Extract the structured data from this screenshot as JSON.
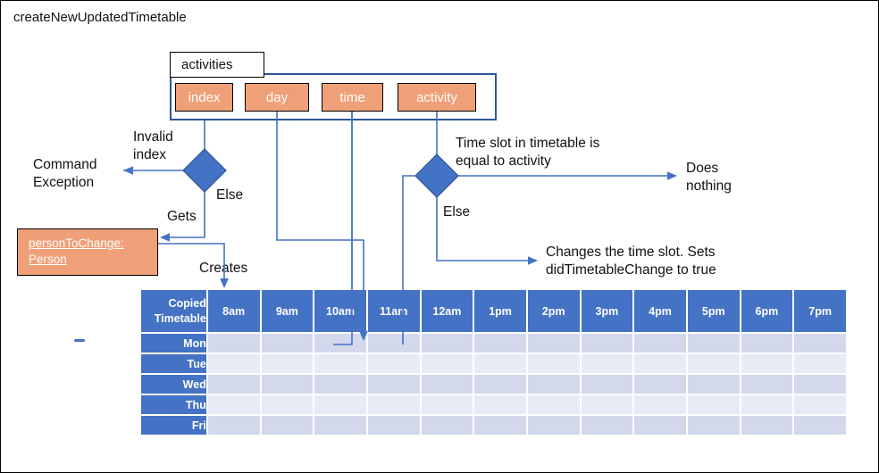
{
  "diagram": {
    "title": "createNewUpdatedTimetable",
    "activities_group": {
      "tab_label": "activities",
      "fields": [
        "index",
        "day",
        "time",
        "activity"
      ]
    },
    "person_object": {
      "line1": "personToChange:",
      "line2": "Person"
    },
    "decision_left": {
      "branch_true": "Invalid\nindex",
      "branch_true_target": "Command\nException",
      "branch_else": "Else",
      "else_edge_label": "Gets"
    },
    "decision_right": {
      "branch_true": "Time slot in timetable is\nequal to activity",
      "branch_true_target": "Does\nnothing",
      "branch_else": "Else",
      "branch_else_target": "Changes the time slot. Sets\ndidTimetableChange to true"
    },
    "creates_label": "Creates",
    "timetable": {
      "corner_label": "Copied\nTimetable",
      "columns": [
        "8am",
        "9am",
        "10am",
        "11am",
        "12am",
        "1pm",
        "2pm",
        "3pm",
        "4pm",
        "5pm",
        "6pm",
        "7pm"
      ],
      "rows": [
        "Mon",
        "Tue",
        "Wed",
        "Thu",
        "Fri"
      ],
      "cells": [
        [
          "",
          "",
          "",
          "",
          "",
          "",
          "",
          "",
          "",
          "",
          "",
          ""
        ],
        [
          "",
          "",
          "",
          "",
          "",
          "",
          "",
          "",
          "",
          "",
          "",
          ""
        ],
        [
          "",
          "",
          "",
          "",
          "",
          "",
          "",
          "",
          "",
          "",
          "",
          ""
        ],
        [
          "",
          "",
          "",
          "",
          "",
          "",
          "",
          "",
          "",
          "",
          "",
          ""
        ],
        [
          "",
          "",
          "",
          "",
          "",
          "",
          "",
          "",
          "",
          "",
          "",
          ""
        ]
      ]
    },
    "colors": {
      "accent_blue": "#4472C4",
      "container_blue": "#2E5597",
      "field_orange": "#EFA078",
      "row_shade_dark": "#D3D8EC",
      "row_shade_light": "#E8EAF5",
      "text": "#111111"
    }
  }
}
